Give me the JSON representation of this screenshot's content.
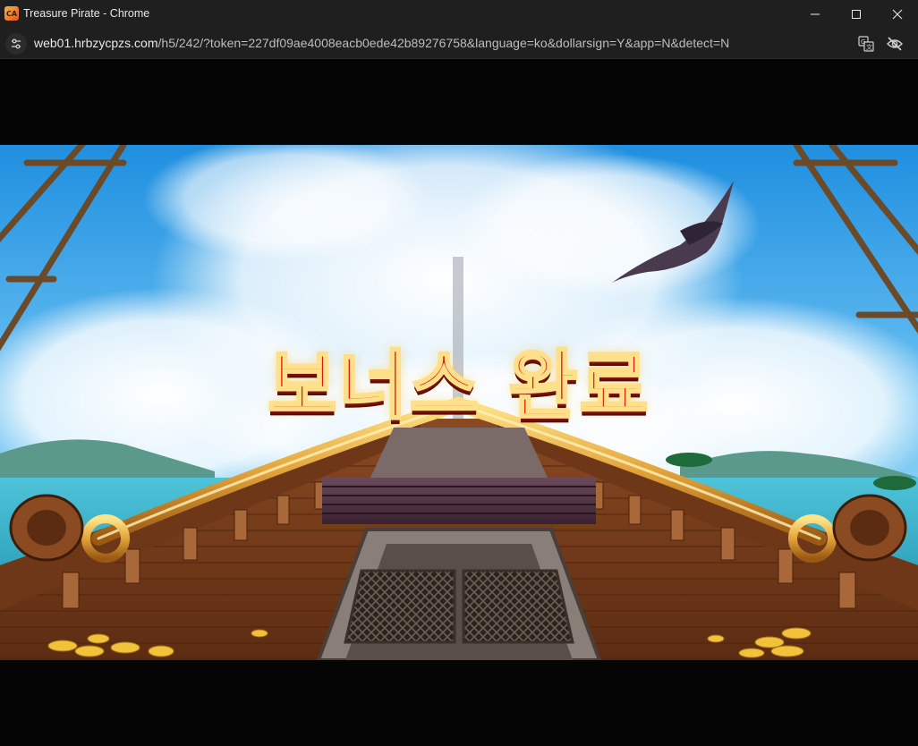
{
  "window": {
    "title": "Treasure Pirate - Chrome",
    "app_icon_text": "CA"
  },
  "address_bar": {
    "host": "web01.hrbzycpzs.com",
    "path": "/h5/242/?token=227df09ae4008eacb0ede42b89276758&language=ko&dollarsign=Y&app=N&detect=N"
  },
  "icons": {
    "site_info": "tune-icon",
    "translate": "translate-icon",
    "visibility": "eye-off-icon",
    "minimize": "minimize-icon",
    "maximize": "maximize-icon",
    "close": "close-icon"
  },
  "game": {
    "banner_text": "보너스 완료"
  },
  "colors": {
    "chrome_bg": "#1f1f1f",
    "banner_red": "#d71d12",
    "banner_outline": "#ffe08a"
  }
}
